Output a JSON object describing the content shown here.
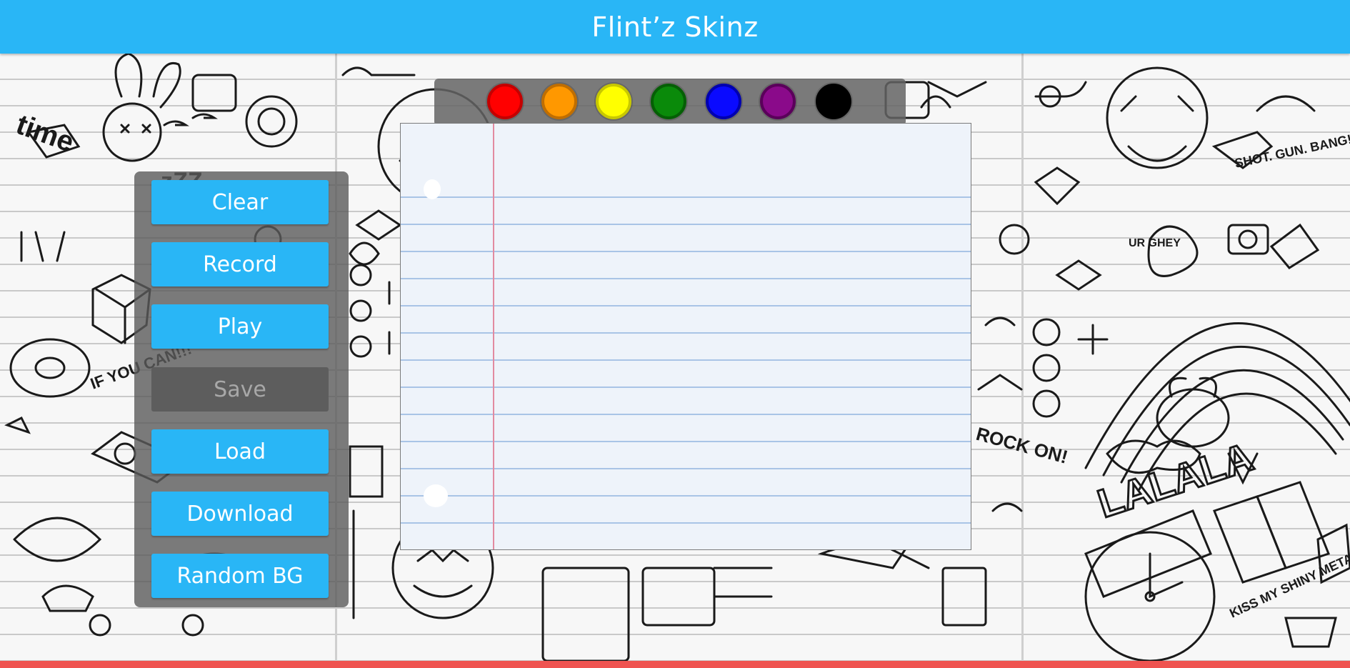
{
  "app": {
    "title": "Flint’z Skinz"
  },
  "controls": {
    "buttons": [
      {
        "label": "Clear",
        "enabled": true
      },
      {
        "label": "Record",
        "enabled": true
      },
      {
        "label": "Play",
        "enabled": true
      },
      {
        "label": "Save",
        "enabled": false
      },
      {
        "label": "Load",
        "enabled": true
      },
      {
        "label": "Download",
        "enabled": true
      },
      {
        "label": "Random BG",
        "enabled": true
      }
    ]
  },
  "palette": {
    "colors": [
      {
        "name": "red",
        "hex": "#ff0000",
        "ring": "#c40000"
      },
      {
        "name": "orange",
        "hex": "#ff9800",
        "ring": "#c06e00"
      },
      {
        "name": "yellow",
        "hex": "#ffff00",
        "ring": "#c8c800"
      },
      {
        "name": "green",
        "hex": "#0a8a0a",
        "ring": "#055f05"
      },
      {
        "name": "blue",
        "hex": "#0a0aff",
        "ring": "#0000b0"
      },
      {
        "name": "purple",
        "hex": "#8a0a8a",
        "ring": "#5a005a"
      },
      {
        "name": "black",
        "hex": "#000000",
        "ring": "#000000"
      }
    ]
  },
  "theme": {
    "accent": "#29b6f6",
    "bottom_bar": "#ef5350"
  }
}
